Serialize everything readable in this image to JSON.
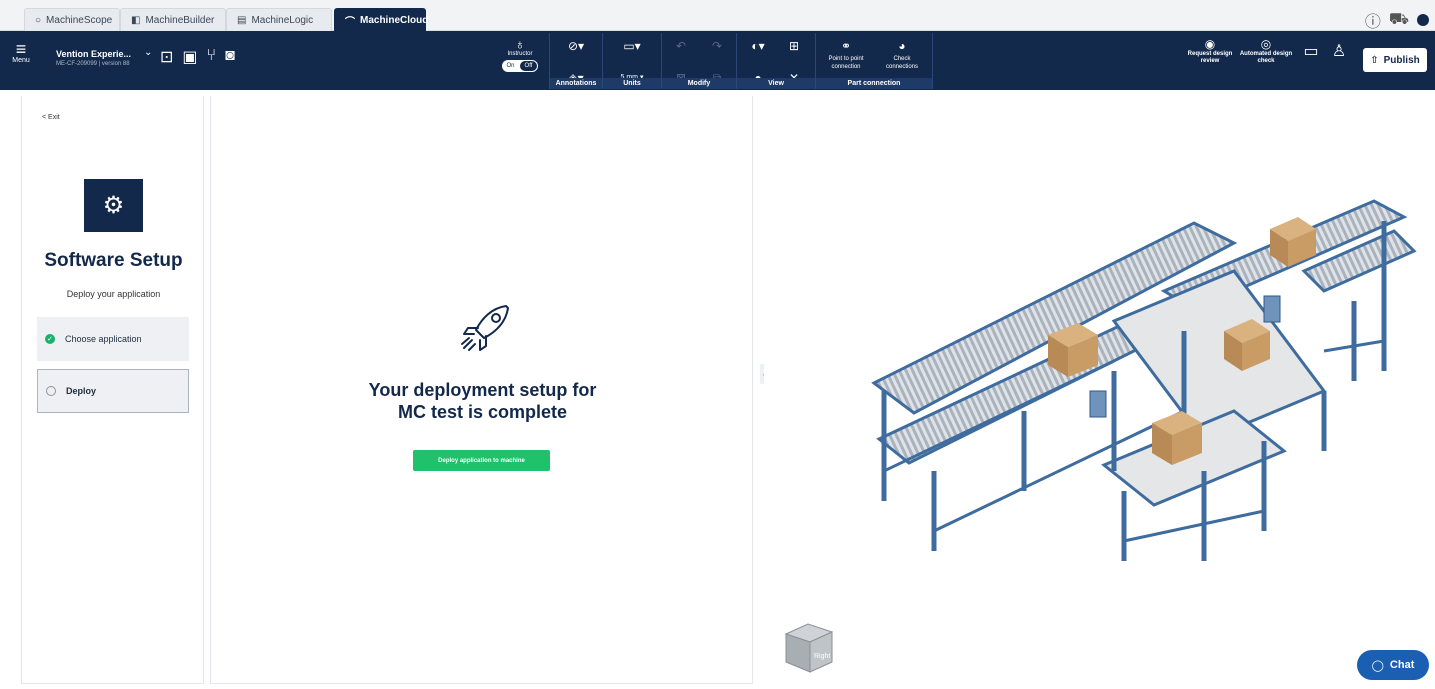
{
  "app_tabs": [
    {
      "label": "MachineScope",
      "icon": "circle-outline-icon"
    },
    {
      "label": "MachineBuilder",
      "icon": "cube-icon"
    },
    {
      "label": "MachineLogic",
      "icon": "logic-icon"
    },
    {
      "label": "MachineCloud",
      "icon": "cloud-icon",
      "active": true
    }
  ],
  "toolbar": {
    "menu_label": "Menu",
    "project_name": "Vention Experie...",
    "project_sub": "ME-CF-209099 | version 88",
    "instructor_label": "Instructor",
    "instructor_on": "On",
    "instructor_off": "Off",
    "units_value": "5 mm",
    "groups": {
      "annotations": "Annotations",
      "units": "Units",
      "modify": "Modify",
      "view": "View",
      "part_connection": "Part connection"
    },
    "point_to_point": "Point to point connection",
    "check_connections": "Check connections",
    "request_review": "Request design review",
    "automated_check": "Automated design check",
    "publish": "Publish"
  },
  "left_panel": {
    "exit": "< Exit",
    "title": "Software Setup",
    "subtitle": "Deploy your application",
    "steps": [
      {
        "label": "Choose application",
        "status": "done"
      },
      {
        "label": "Deploy",
        "status": "current"
      }
    ]
  },
  "main": {
    "heading_line1": "Your deployment setup for",
    "heading_line2": "MC test is complete",
    "deploy_button": "Deploy application to machine"
  },
  "viewport": {
    "navcube_label": "Right",
    "chat": "Chat"
  },
  "colors": {
    "navy": "#13294b",
    "green": "#1fc16a",
    "success": "#18b26b",
    "chat_blue": "#1b5fb3"
  }
}
